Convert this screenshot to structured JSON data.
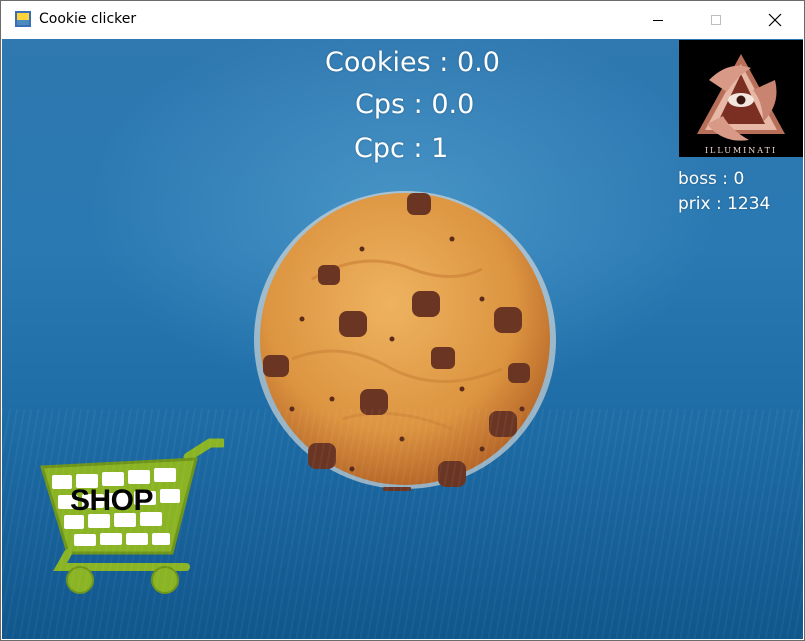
{
  "window": {
    "title": "Cookie clicker"
  },
  "hud": {
    "cookies_label": "Cookies : 0.0",
    "cps_label": "Cps : 0.0",
    "cpc_label": "Cpc : 1"
  },
  "boss": {
    "image_caption": "ILLUMINATI",
    "count_label": "boss : 0",
    "price_label": "prix : 1234"
  },
  "shop": {
    "label": "SHOP"
  },
  "colors": {
    "background": "#2a79b2",
    "text": "#ffffff",
    "cart": "#8ab424"
  },
  "icons": [
    "app-icon",
    "minimize-icon",
    "maximize-icon",
    "close-icon",
    "cookie",
    "shop-cart-icon",
    "illuminati-icon"
  ]
}
